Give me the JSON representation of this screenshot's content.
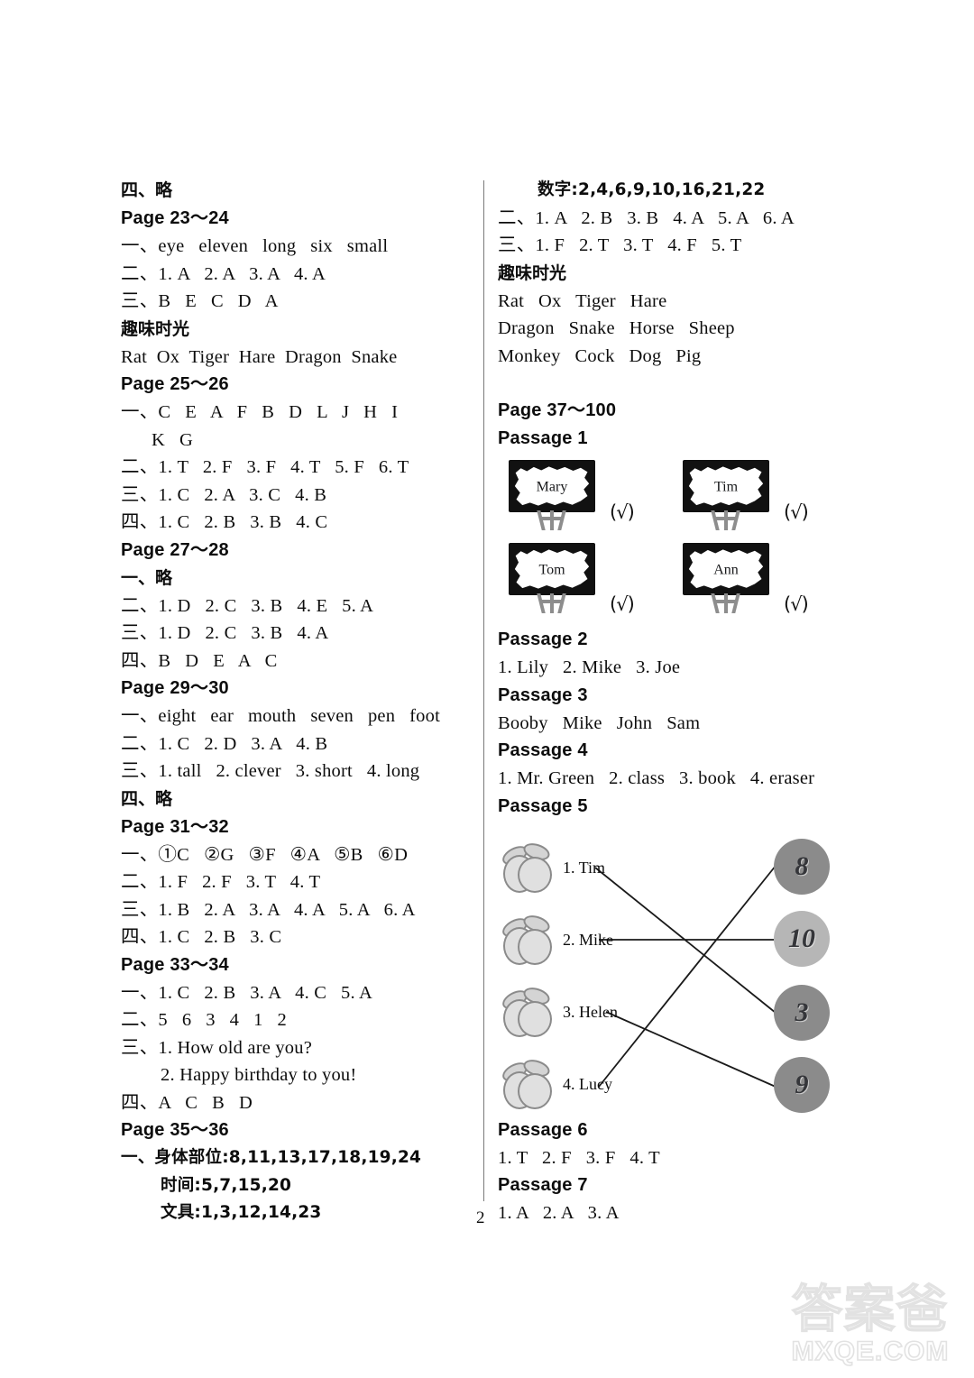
{
  "page": {
    "number": "2",
    "watermark_cn": "答案爸",
    "watermark_en": "MXQE.COM"
  },
  "left_column": {
    "pre_lines": [
      {
        "type": "cn-line",
        "text": "四、略"
      }
    ],
    "sections": [
      {
        "heading": "Page 23～24",
        "lines": [
          "一、eye   eleven   long   six   small",
          "二、1. A   2. A   3. A   4. A",
          "三、B   E   C   D   A"
        ],
        "sub_heading": "趣味时光",
        "sub_lines": [
          "Rat  Ox  Tiger  Hare  Dragon  Snake"
        ]
      },
      {
        "heading": "Page 25～26",
        "lines": [
          "一、C   E   A   F   B   D   L   J   H   I",
          "K   G",
          "二、1. T   2. F   3. F   4. T   5. F   6. T",
          "三、1. C   2. A   3. C   4. B",
          "四、1. C   2. B   3. B   4. C"
        ],
        "indent_flags": [
          false,
          true,
          false,
          false,
          false
        ]
      },
      {
        "heading": "Page 27～28",
        "lines": [
          "一、略",
          "二、1. D   2. C   3. B   4. E   5. A",
          "三、1. D   2. C   3. B   4. A",
          "四、B   D   E   A   C"
        ]
      },
      {
        "heading": "Page 29～30",
        "lines": [
          "一、eight   ear   mouth   seven   pen   foot",
          "二、1. C   2. D   3. A   4. B",
          "三、1. tall   2. clever   3. short   4. long",
          "四、略"
        ]
      },
      {
        "heading": "Page 31～32",
        "lines": [
          "一、①C   ②G   ③F   ④A   ⑤B   ⑥D",
          "二、1. F   2. F   3. T   4. T",
          "三、1. B   2. A   3. A   4. A   5. A   6. A",
          "四、1. C   2. B   3. C"
        ]
      },
      {
        "heading": "Page 33～34",
        "lines": [
          "一、1. C   2. B   3. A   4. C   5. A",
          "二、5   6   3   4   1   2",
          "三、1. How old are you?",
          "2. Happy birthday to you!",
          "四、A   C   B   D"
        ],
        "indent_flags": [
          false,
          false,
          false,
          true,
          false
        ]
      },
      {
        "heading": "Page 35～36",
        "lines": [
          "一、身体部位:8,11,13,17,18,19,24",
          "时间:5,7,15,20",
          "文具:1,3,12,14,23"
        ],
        "indent_flags": [
          false,
          true,
          true
        ]
      }
    ]
  },
  "right_column": {
    "top_lines": [
      {
        "text": "数字:2,4,6,9,10,16,21,22",
        "indent": true
      },
      {
        "text": "二、1. A   2. B   3. B   4. A   5. A   6. A",
        "indent": false
      },
      {
        "text": "三、1. F   2. T   3. T   4. F   5. T",
        "indent": false
      }
    ],
    "fun_heading": "趣味时光",
    "fun_lines": [
      "Rat   Ox   Tiger   Hare",
      "Dragon   Snake   Horse   Sheep",
      "Monkey   Cock   Dog   Pig"
    ],
    "page_heading": "Page 37～100",
    "passages": [
      {
        "title": "Passage 1",
        "type": "easels",
        "items": [
          {
            "name": "Mary",
            "mark": "(√)"
          },
          {
            "name": "Tim",
            "mark": "(√)"
          },
          {
            "name": "Tom",
            "mark": "(√)"
          },
          {
            "name": "Ann",
            "mark": "(√)"
          }
        ]
      },
      {
        "title": "Passage 2",
        "type": "text",
        "lines": [
          "1. Lily   2. Mike   3. Joe"
        ]
      },
      {
        "title": "Passage 3",
        "type": "text",
        "lines": [
          "Booby   Mike   John   Sam"
        ]
      },
      {
        "title": "Passage 4",
        "type": "text",
        "lines": [
          "1. Mr. Green   2. class   3. book   4. eraser"
        ]
      },
      {
        "title": "Passage 5",
        "type": "matching",
        "left_items": [
          {
            "label": "1. Tim",
            "icon": "peach-icon"
          },
          {
            "label": "2. Mike",
            "icon": "peach-icon"
          },
          {
            "label": "3. Helen",
            "icon": "peach-icon"
          },
          {
            "label": "4. Lucy",
            "icon": "peach-icon"
          }
        ],
        "right_items": [
          {
            "value": "8",
            "shade": "dark"
          },
          {
            "value": "10",
            "shade": "light"
          },
          {
            "value": "3",
            "shade": "dark"
          },
          {
            "value": "9",
            "shade": "dark"
          }
        ],
        "connections": [
          {
            "from": 0,
            "to": 2
          },
          {
            "from": 1,
            "to": 1
          },
          {
            "from": 2,
            "to": 3
          },
          {
            "from": 3,
            "to": 0
          }
        ]
      },
      {
        "title": "Passage 6",
        "type": "text",
        "lines": [
          "1. T   2. F   3. F   4. T"
        ]
      },
      {
        "title": "Passage 7",
        "type": "text",
        "lines": [
          "1. A   2. A   3. A"
        ]
      }
    ]
  }
}
